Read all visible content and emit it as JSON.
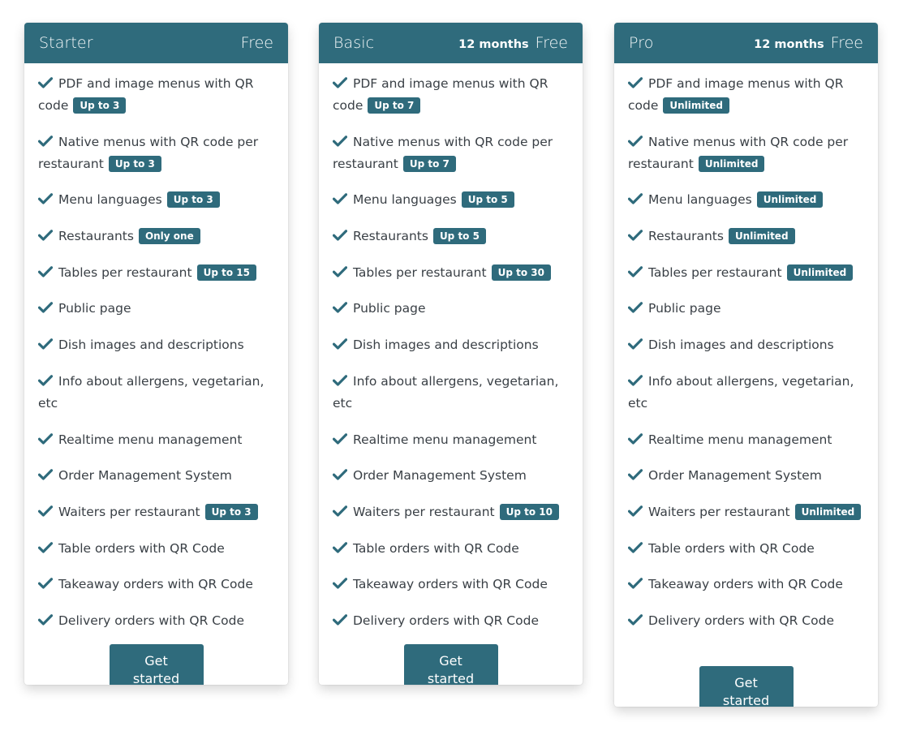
{
  "accent_color": "#2f6b7c",
  "plans": [
    {
      "name": "Starter",
      "duration": "",
      "price": "Free",
      "button_label": "Get started",
      "features": [
        {
          "text": "PDF and image menus with QR code",
          "badge": "Up to 3"
        },
        {
          "text": "Native menus with QR code per restaurant",
          "badge": "Up to 3"
        },
        {
          "text": "Menu languages",
          "badge": "Up to 3"
        },
        {
          "text": "Restaurants",
          "badge": "Only one"
        },
        {
          "text": "Tables per restaurant",
          "badge": "Up to 15"
        },
        {
          "text": "Public page",
          "badge": ""
        },
        {
          "text": "Dish images and descriptions",
          "badge": ""
        },
        {
          "text": "Info about allergens, vegetarian, etc",
          "badge": ""
        },
        {
          "text": "Realtime menu management",
          "badge": ""
        },
        {
          "text": "Order Management System",
          "badge": ""
        },
        {
          "text": "Waiters per restaurant",
          "badge": "Up to 3"
        },
        {
          "text": "Table orders with QR Code",
          "badge": ""
        },
        {
          "text": "Takeaway orders with QR Code",
          "badge": ""
        },
        {
          "text": "Delivery orders with QR Code",
          "badge": ""
        }
      ]
    },
    {
      "name": "Basic",
      "duration": "12 months",
      "price": "Free",
      "button_label": "Get started",
      "features": [
        {
          "text": "PDF and image menus with QR code",
          "badge": "Up to 7"
        },
        {
          "text": "Native menus with QR code per restaurant",
          "badge": "Up to 7"
        },
        {
          "text": "Menu languages",
          "badge": "Up to 5"
        },
        {
          "text": "Restaurants",
          "badge": "Up to 5"
        },
        {
          "text": "Tables per restaurant",
          "badge": "Up to 30"
        },
        {
          "text": "Public page",
          "badge": ""
        },
        {
          "text": "Dish images and descriptions",
          "badge": ""
        },
        {
          "text": "Info about allergens, vegetarian, etc",
          "badge": ""
        },
        {
          "text": "Realtime menu management",
          "badge": ""
        },
        {
          "text": "Order Management System",
          "badge": ""
        },
        {
          "text": "Waiters per restaurant",
          "badge": "Up to 10"
        },
        {
          "text": "Table orders with QR Code",
          "badge": ""
        },
        {
          "text": "Takeaway orders with QR Code",
          "badge": ""
        },
        {
          "text": "Delivery orders with QR Code",
          "badge": ""
        }
      ]
    },
    {
      "name": "Pro",
      "duration": "12 months",
      "price": "Free",
      "button_label": "Get started",
      "features": [
        {
          "text": "PDF and image menus with QR code",
          "badge": "Unlimited"
        },
        {
          "text": "Native menus with QR code per restaurant",
          "badge": "Unlimited"
        },
        {
          "text": "Menu languages",
          "badge": "Unlimited"
        },
        {
          "text": "Restaurants",
          "badge": "Unlimited"
        },
        {
          "text": "Tables per restaurant",
          "badge": "Unlimited"
        },
        {
          "text": "Public page",
          "badge": ""
        },
        {
          "text": "Dish images and descriptions",
          "badge": ""
        },
        {
          "text": "Info about allergens, vegetarian, etc",
          "badge": ""
        },
        {
          "text": "Realtime menu management",
          "badge": ""
        },
        {
          "text": "Order Management System",
          "badge": ""
        },
        {
          "text": "Waiters per restaurant",
          "badge": "Unlimited"
        },
        {
          "text": "Table orders with QR Code",
          "badge": ""
        },
        {
          "text": "Takeaway orders with QR Code",
          "badge": ""
        },
        {
          "text": "Delivery orders with QR Code",
          "badge": ""
        }
      ]
    }
  ]
}
